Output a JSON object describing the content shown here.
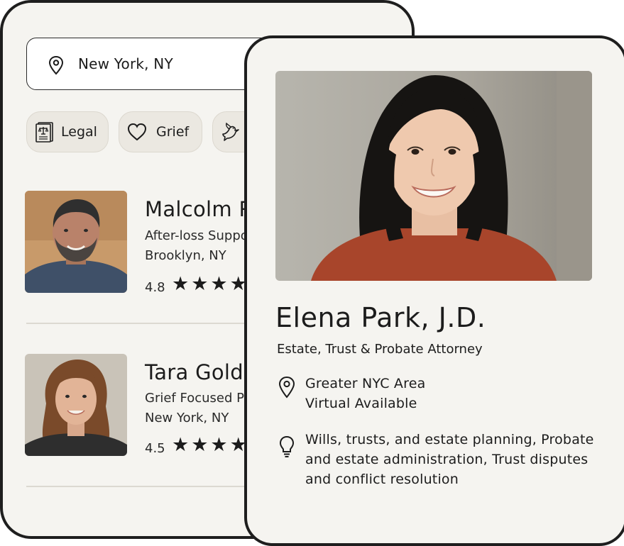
{
  "search": {
    "location": "New York, NY",
    "icon": "map-pin-icon"
  },
  "chips": [
    {
      "label": "Legal",
      "icon": "legal-document-icon"
    },
    {
      "label": "Grief",
      "icon": "heart-icon"
    },
    {
      "label": "",
      "icon": "dove-icon"
    }
  ],
  "providers": [
    {
      "name": "Malcolm R",
      "specialty": "After-loss Suppor",
      "location": "Brooklyn, NY",
      "rating": "4.8",
      "stars": "★★★★"
    },
    {
      "name": "Tara Goldb",
      "specialty": "Grief Focused Ps",
      "location": "New York, NY",
      "rating": "4.5",
      "stars": "★★★★"
    }
  ],
  "profile": {
    "name": "Elena Park, J.D.",
    "title": "Estate, Trust & Probate Attorney",
    "location_lines": [
      "Greater NYC Area",
      "Virtual Available"
    ],
    "specialties_lines": [
      "Wills, trusts, and estate planning, Probate",
      "and estate administration, Trust disputes",
      "and conflict resolution"
    ]
  },
  "colors": {
    "card_bg": "#f5f4f0",
    "chip_bg": "#ebe8e1",
    "border": "#1e1e1e",
    "sweater": "#a8452b"
  }
}
